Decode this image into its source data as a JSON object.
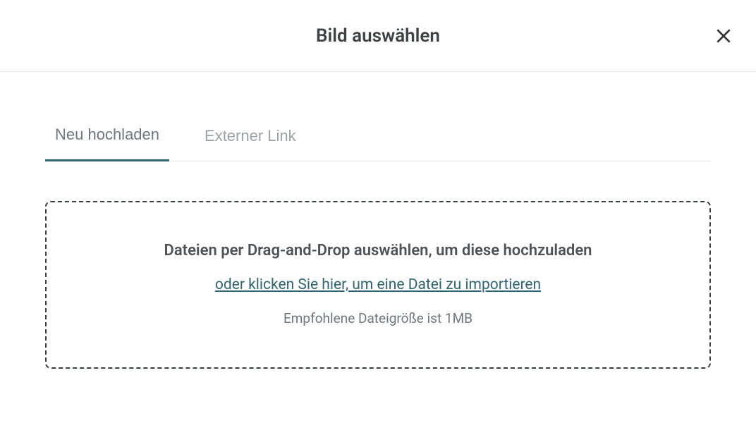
{
  "header": {
    "title": "Bild auswählen"
  },
  "tabs": [
    {
      "label": "Neu hochladen"
    },
    {
      "label": "Externer Link"
    }
  ],
  "dropzone": {
    "heading": "Dateien per Drag-and-Drop auswählen, um diese hochzuladen",
    "link": "oder klicken Sie hier, um eine Datei zu importieren",
    "hint": "Empfohlene Dateigröße ist 1MB"
  }
}
